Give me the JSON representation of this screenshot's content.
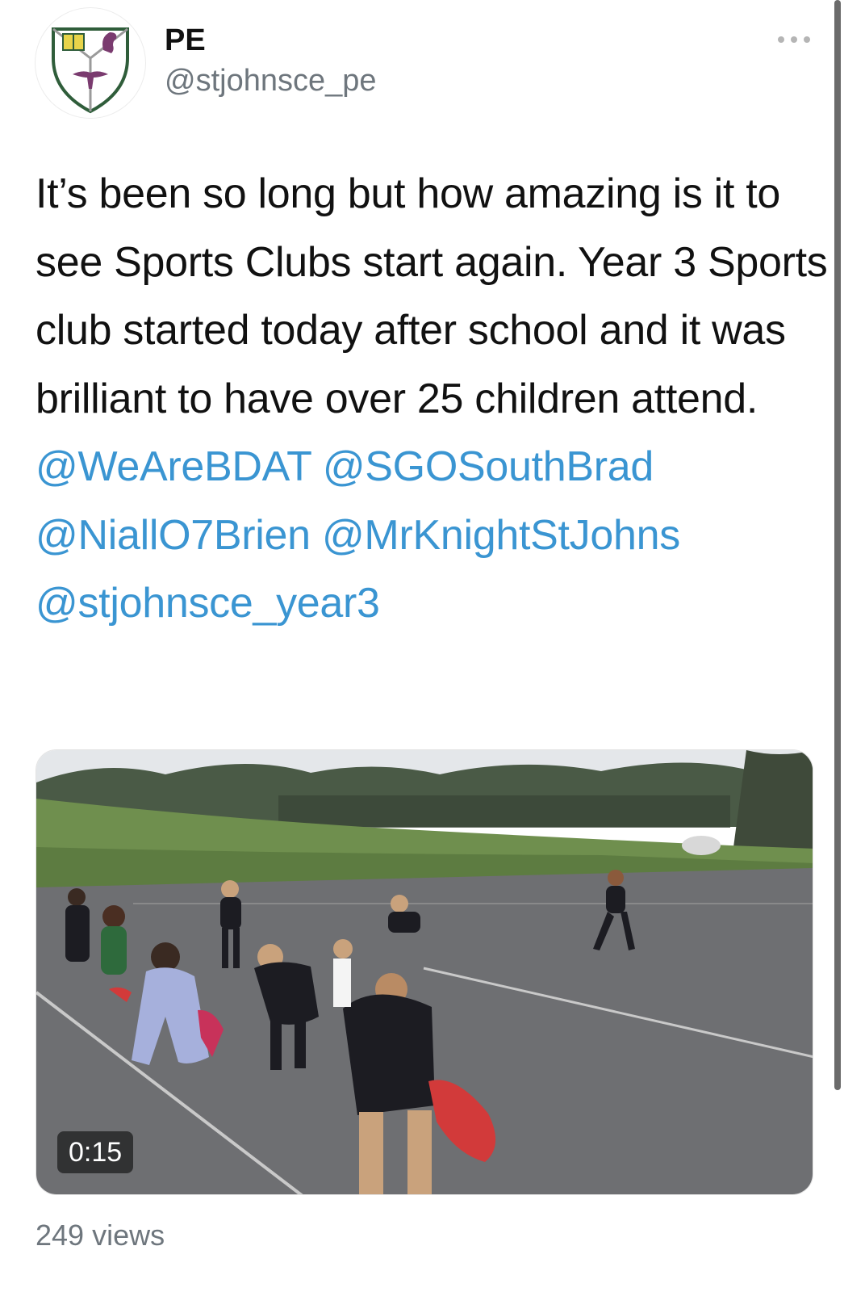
{
  "author": {
    "display_name": "PE",
    "handle": "@stjohnsce_pe",
    "avatar_icon": "school-crest-icon"
  },
  "menu": {
    "icon": "more-options-icon"
  },
  "tweet": {
    "text_main": "It’s been so long but how amazing is it to see Sports Clubs start again. Year 3 Sports club started today after school and it was brilliant to have over 25 children attend.",
    "mentions": [
      "@WeAreBDAT",
      "@SGOSouthBrad",
      "@NiallO7Brien",
      "@MrKnightStJohns",
      "@stjohnsce_year3"
    ]
  },
  "media": {
    "type": "video",
    "duration": "0:15",
    "views": "249 views"
  },
  "colors": {
    "mention": "#3a95d2",
    "secondary_text": "#6e767d",
    "crest_purple": "#7a3b6f",
    "crest_green": "#2f5d3a",
    "crest_yellow": "#e8d44a"
  }
}
